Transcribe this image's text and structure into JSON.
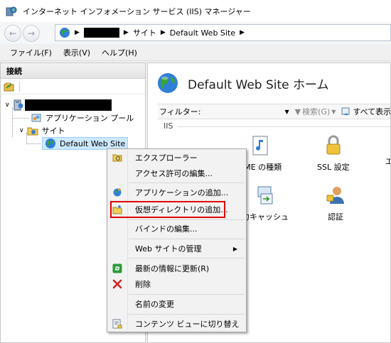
{
  "window": {
    "title": "インターネット インフォメーション サービス (IIS) マネージャー"
  },
  "address": {
    "crumbs": [
      "サイト",
      "Default Web Site"
    ]
  },
  "menu": {
    "items": [
      "ファイル(F)",
      "表示(V)",
      "ヘルプ(H)"
    ]
  },
  "connections": {
    "header": "接続",
    "tree": {
      "app_pools": "アプリケーション プール",
      "sites": "サイト",
      "default_site": "Default Web Site"
    }
  },
  "home": {
    "title": "Default Web Site ホーム",
    "filter_label": "フィルター:",
    "search_label": "検索(G)",
    "show_all_label": "すべて表示",
    "group": "IIS",
    "features": {
      "mime": "IME の種類",
      "ssl": "SSL 設定",
      "partial_right": "エ",
      "cache": "力キャッシュ",
      "auth": "認証"
    }
  },
  "context_menu": {
    "explore": "エクスプローラー",
    "edit_permissions": "アクセス許可の編集...",
    "add_application": "アプリケーションの追加...",
    "add_virtual_directory": "仮想ディレクトリの追加...",
    "edit_bindings": "バインドの編集...",
    "manage_website": "Web サイトの管理",
    "refresh": "最新の情報に更新(R)",
    "remove": "削除",
    "rename": "名前の変更",
    "switch_content_view": "コンテンツ ビューに切り替え"
  },
  "colors": {
    "highlight": "#e00000",
    "selection": "#cce8ff"
  }
}
